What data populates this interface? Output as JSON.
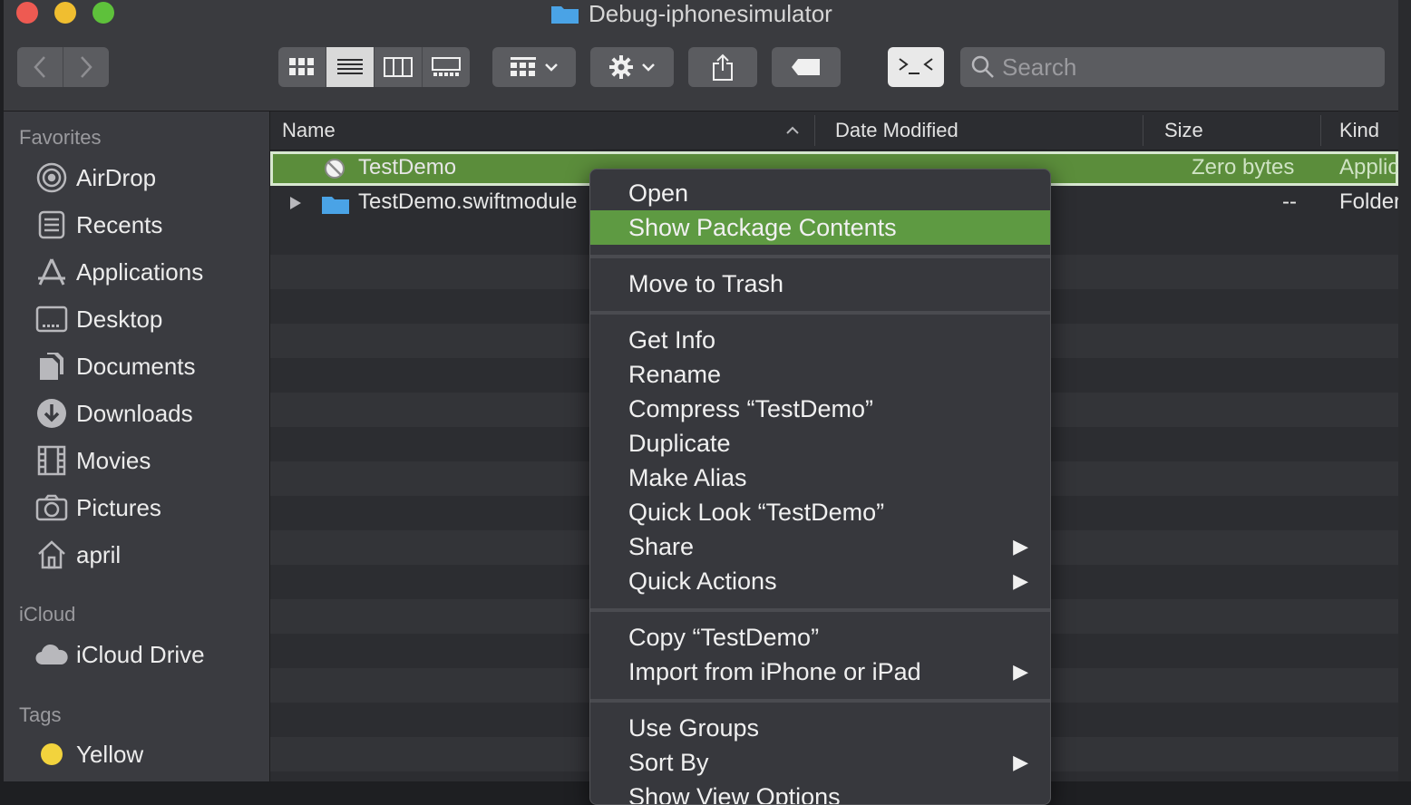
{
  "window": {
    "title": "Debug-iphonesimulator"
  },
  "search": {
    "placeholder": "Search"
  },
  "sidebar": {
    "favorites_header": "Favorites",
    "favorites": [
      {
        "label": "AirDrop",
        "icon": "airdrop-icon"
      },
      {
        "label": "Recents",
        "icon": "recents-icon"
      },
      {
        "label": "Applications",
        "icon": "applications-icon"
      },
      {
        "label": "Desktop",
        "icon": "desktop-icon"
      },
      {
        "label": "Documents",
        "icon": "documents-icon"
      },
      {
        "label": "Downloads",
        "icon": "downloads-icon"
      },
      {
        "label": "Movies",
        "icon": "movies-icon"
      },
      {
        "label": "Pictures",
        "icon": "pictures-icon"
      },
      {
        "label": "april",
        "icon": "home-icon"
      }
    ],
    "icloud_header": "iCloud",
    "icloud": [
      {
        "label": "iCloud Drive",
        "icon": "cloud-icon"
      }
    ],
    "tags_header": "Tags",
    "tags": [
      {
        "label": "Yellow",
        "color": "#f2d33d"
      }
    ]
  },
  "columns": {
    "name": "Name",
    "date": "Date Modified",
    "size": "Size",
    "kind": "Kind"
  },
  "files": [
    {
      "name": "TestDemo",
      "date": "",
      "size": "Zero bytes",
      "kind": "Applic",
      "selected": true
    },
    {
      "name": "TestDemo.swiftmodule",
      "date": "",
      "size": "--",
      "kind": "Folder/"
    }
  ],
  "context_menu": {
    "open": "Open",
    "show_package": "Show Package Contents",
    "move_trash": "Move to Trash",
    "get_info": "Get Info",
    "rename": "Rename",
    "compress": "Compress “TestDemo”",
    "duplicate": "Duplicate",
    "make_alias": "Make Alias",
    "quick_look": "Quick Look “TestDemo”",
    "share": "Share",
    "quick_actions": "Quick Actions",
    "copy": "Copy “TestDemo”",
    "import": "Import from iPhone or iPad",
    "use_groups": "Use Groups",
    "sort_by": "Sort By",
    "show_view_options": "Show View Options"
  },
  "colors": {
    "selection_green": "#5b8d3b",
    "menu_highlight": "#5e9a42"
  }
}
